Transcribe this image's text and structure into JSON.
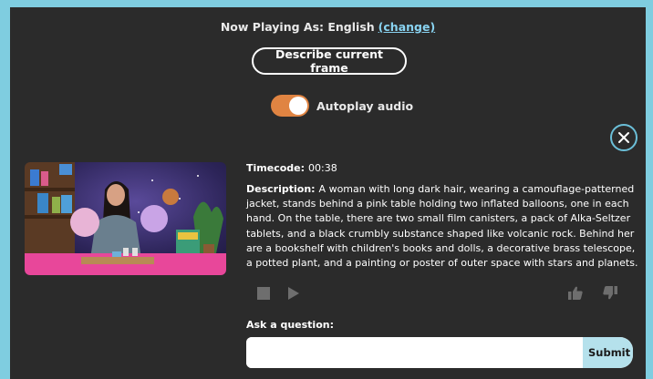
{
  "header": {
    "now_playing_prefix": "Now Playing As: English",
    "change_link": "(change)"
  },
  "describe_button": "Describe current frame",
  "autoplay": {
    "label": "Autoplay audio",
    "enabled": true
  },
  "frame": {
    "timecode_label": "Timecode:",
    "timecode_value": "00:38",
    "description_label": "Description:",
    "description_text": "A woman with long dark hair, wearing a camouflage-patterned jacket, stands behind a pink table holding two inflated balloons, one in each hand. On the table, there are two small film canisters, a pack of Alka-Seltzer tablets, and a black crumbly substance shaped like volcanic rock. Behind her are a bookshelf with children's books and dolls, a decorative brass telescope, a potted plant, and a painting or poster of outer space with stars and planets."
  },
  "question": {
    "label": "Ask a question:",
    "input_value": "",
    "submit_label": "Submit"
  },
  "icons": {
    "stop": "stop-icon",
    "play": "play-icon",
    "thumbs_up": "thumbs-up-icon",
    "thumbs_down": "thumbs-down-icon",
    "close": "close-icon"
  },
  "colors": {
    "background": "#2b2b2b",
    "border_accent": "#7fcde0",
    "toggle_on": "#e08442",
    "link": "#89d3f1",
    "submit_bg": "#b5e1ec"
  }
}
